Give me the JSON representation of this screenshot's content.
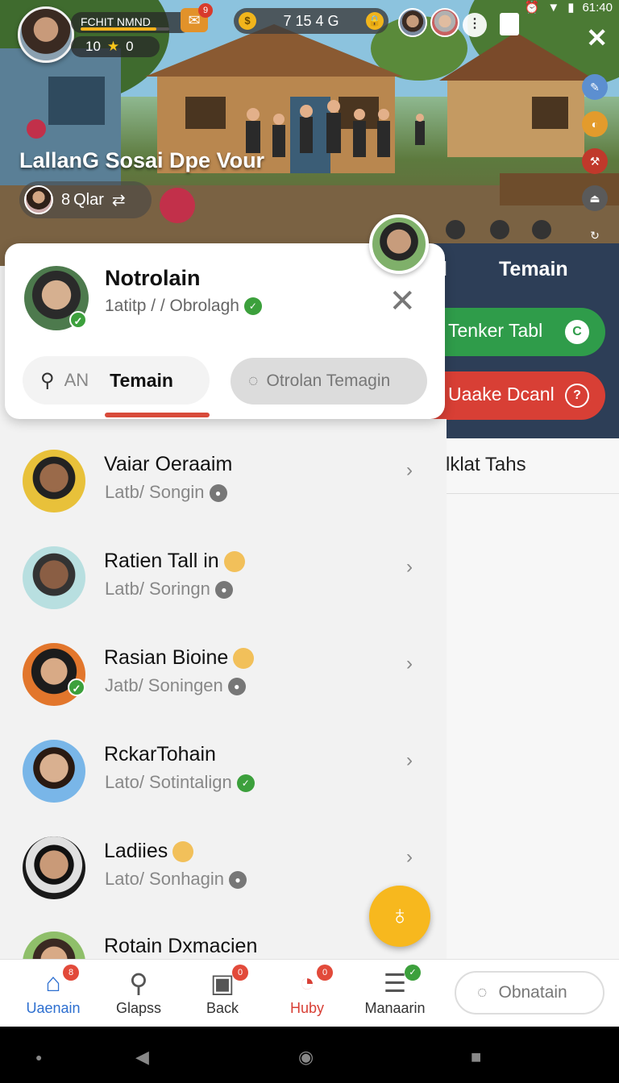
{
  "status_bar": {
    "time": "61:40"
  },
  "player": {
    "name": "FCHIT NMND",
    "level": "10",
    "star": "★",
    "badge": "0",
    "xp_ratio": 0.85
  },
  "mail": {
    "icon": "mail-icon",
    "count": "9"
  },
  "currency": {
    "amount": "7 15 4 G",
    "left_icon": "coin-icon",
    "right_icon": "lock-coin-icon"
  },
  "scene": {
    "event_title": "LallanG Sosai Dpe Vour",
    "clan_pill": {
      "count": "8",
      "label": "Qlar"
    }
  },
  "friends_card": {
    "title": "Notrolain",
    "subtitle": "1atitp / / Obrolagh",
    "tabs": {
      "search_short": "AN",
      "active": "Temain",
      "other": "Otrolan Temagin"
    }
  },
  "friends": [
    {
      "name": "Vaiar Oeraaim",
      "status": "Latb/ Songin",
      "status_kind": "idle",
      "emoji": false,
      "online": false,
      "avatar_bg": "#e8c13a"
    },
    {
      "name": "Ratien Tall in",
      "status": "Latb/ Soringn",
      "status_kind": "idle",
      "emoji": true,
      "online": false,
      "avatar_bg": "#b8dfe0"
    },
    {
      "name": "Rasian Bioine",
      "status": "Jatb/ Soningen",
      "status_kind": "idle",
      "emoji": true,
      "online": true,
      "avatar_bg": "#e2762c"
    },
    {
      "name": "RckarTohain",
      "status": "Lato/ Sotintalign",
      "status_kind": "ok",
      "emoji": false,
      "online": false,
      "avatar_bg": "#79b6e8"
    },
    {
      "name": "Ladiies",
      "status": "Lato/ Sonhagin",
      "status_kind": "idle",
      "emoji": true,
      "online": false,
      "avatar_bg": "#1a1a1a"
    },
    {
      "name": "Rotain Dxmacien",
      "status": "",
      "status_kind": "none",
      "emoji": false,
      "online": false,
      "avatar_bg": "#8fbf6a"
    }
  ],
  "right_panel": {
    "tab_pipe": "l",
    "tab_label": "Temain",
    "green_button": "Tenker Tabl",
    "red_button": "Uaake Dcanl",
    "section_label": "lklat Tahs"
  },
  "bottom_nav": {
    "items": [
      {
        "label": "Uaenain",
        "icon": "home-icon",
        "badge": "8",
        "active": true
      },
      {
        "label": "Glapss",
        "icon": "search-icon",
        "badge": "",
        "active": false
      },
      {
        "label": "Back",
        "icon": "inventory-icon",
        "badge": "0",
        "active": false
      },
      {
        "label": "Huby",
        "icon": "hub-icon",
        "badge": "0",
        "active": true
      },
      {
        "label": "Manaarin",
        "icon": "menu-icon",
        "badge": "✓",
        "active": false
      }
    ],
    "pill_label": "Obnatain"
  },
  "colors": {
    "accent_red": "#d84a3a",
    "green": "#2f9c4a",
    "red": "#d83f35",
    "panel_navy": "#2d3e57",
    "fab_yellow": "#f7b81e",
    "nav_active_blue": "#2d6fd0",
    "nav_active_red": "#d83f35"
  }
}
